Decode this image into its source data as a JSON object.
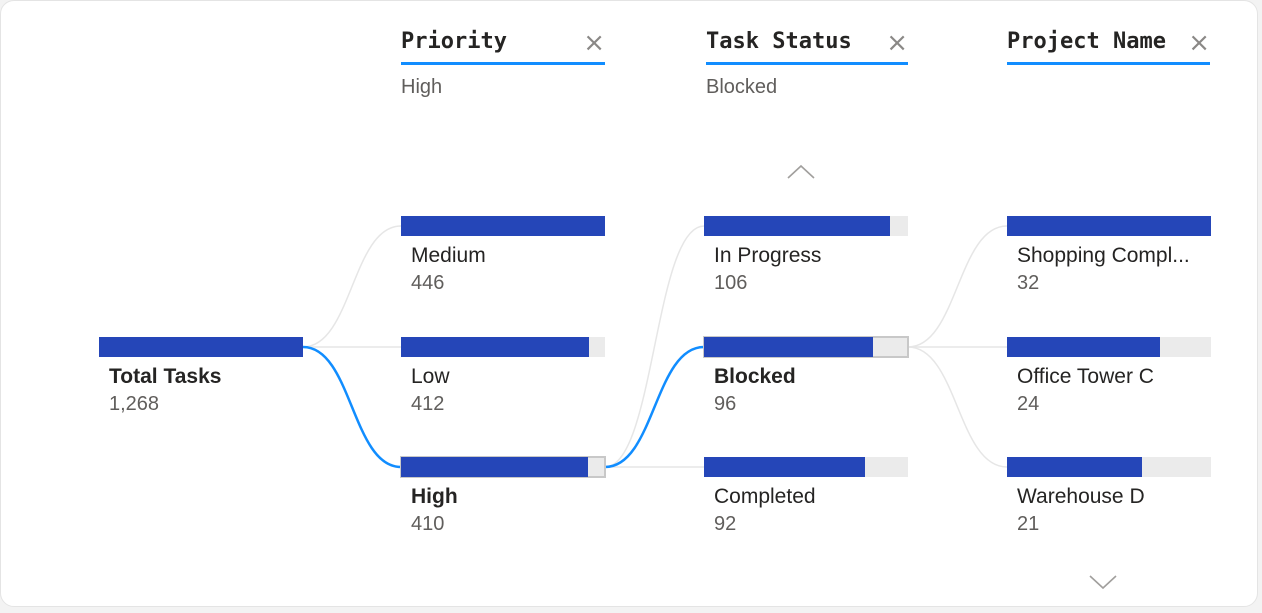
{
  "root": {
    "label": "Total Tasks",
    "value": "1,268",
    "fill": 1.0
  },
  "columns": [
    {
      "title": "Priority",
      "filter": "High",
      "nodes": [
        {
          "label": "Medium",
          "value": "446",
          "fill": 1.0,
          "selected": false
        },
        {
          "label": "Low",
          "value": "412",
          "fill": 0.924,
          "selected": false
        },
        {
          "label": "High",
          "value": "410",
          "fill": 0.919,
          "selected": true
        }
      ]
    },
    {
      "title": "Task Status",
      "filter": "Blocked",
      "nodes": [
        {
          "label": "In Progress",
          "value": "106",
          "fill": 0.91,
          "selected": false
        },
        {
          "label": "Blocked",
          "value": "96",
          "fill": 0.83,
          "selected": true
        },
        {
          "label": "Completed",
          "value": "92",
          "fill": 0.79,
          "selected": false
        }
      ]
    },
    {
      "title": "Project Name",
      "filter": "",
      "nodes": [
        {
          "label": "Shopping Compl...",
          "value": "32",
          "fill": 1.0,
          "selected": false
        },
        {
          "label": "Office Tower C",
          "value": "24",
          "fill": 0.75,
          "selected": false
        },
        {
          "label": "Warehouse D",
          "value": "21",
          "fill": 0.66,
          "selected": false
        }
      ]
    }
  ],
  "close_glyph": "×",
  "colors": {
    "bar_fill": "#2546b8",
    "bar_track": "#ebebeb",
    "active_link": "#118dff",
    "inactive_link": "#e6e6e6",
    "header_underline": "#118dff"
  },
  "icons": {
    "close": "close-icon",
    "scroll_up": "chevron-up-icon",
    "scroll_down": "chevron-down-icon"
  }
}
